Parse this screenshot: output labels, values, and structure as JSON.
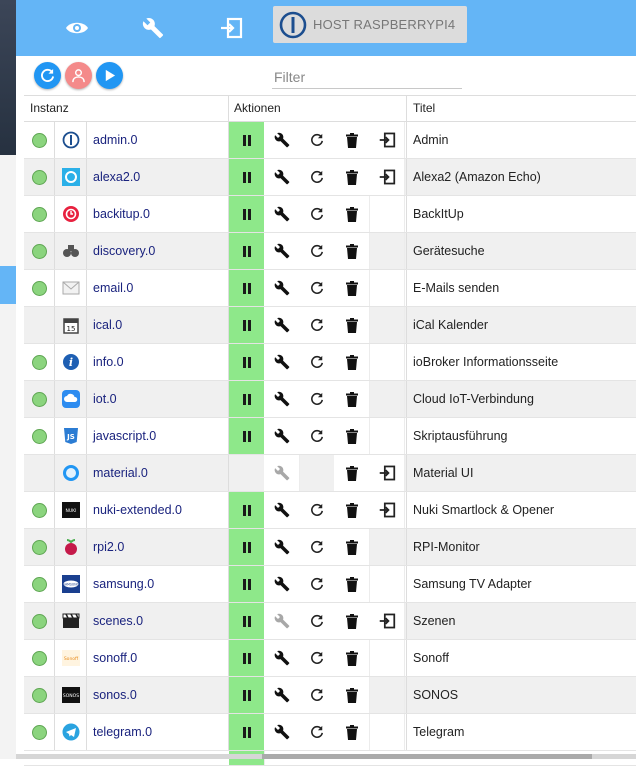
{
  "topbar": {
    "icons": [
      "eye-icon",
      "wrench-icon",
      "login-icon"
    ],
    "host_label": "HOST RASPBERRYPI4"
  },
  "toolbar": {
    "buttons": [
      "refresh-icon",
      "expert-mode-icon",
      "play-icon"
    ],
    "filter_placeholder": "Filter"
  },
  "colors": {
    "accent": "#64b5f6",
    "status_ok": "#8bd47e",
    "pause_bg": "#8ee88a",
    "link": "#1a237e"
  },
  "table": {
    "headers": {
      "instance": "Instanz",
      "actions": "Aktionen",
      "title": "Titel"
    },
    "rows": [
      {
        "instance": "admin.0",
        "title": "Admin",
        "status": true,
        "icon": "iobroker-logo-icon",
        "pause": true,
        "config": true,
        "restart": true,
        "delete": true,
        "open": true
      },
      {
        "instance": "alexa2.0",
        "title": "Alexa2 (Amazon Echo)",
        "status": true,
        "icon": "alexa-icon",
        "pause": true,
        "config": true,
        "restart": true,
        "delete": true,
        "open": true
      },
      {
        "instance": "backitup.0",
        "title": "BackItUp",
        "status": true,
        "icon": "backitup-icon",
        "pause": true,
        "config": true,
        "restart": true,
        "delete": true,
        "open": false
      },
      {
        "instance": "discovery.0",
        "title": "Gerätesuche",
        "status": true,
        "icon": "binoculars-icon",
        "pause": true,
        "config": true,
        "restart": true,
        "delete": true,
        "open": false
      },
      {
        "instance": "email.0",
        "title": "E-Mails senden",
        "status": true,
        "icon": "envelope-icon",
        "pause": true,
        "config": true,
        "restart": true,
        "delete": true,
        "open": false
      },
      {
        "instance": "ical.0",
        "title": "iCal Kalender",
        "status": false,
        "icon": "calendar-icon",
        "pause": true,
        "config": true,
        "restart": true,
        "delete": true,
        "open": false
      },
      {
        "instance": "info.0",
        "title": "ioBroker Informationsseite",
        "status": true,
        "icon": "info-icon",
        "pause": true,
        "config": true,
        "restart": true,
        "delete": true,
        "open": false
      },
      {
        "instance": "iot.0",
        "title": "Cloud IoT-Verbindung",
        "status": true,
        "icon": "cloud-icon",
        "pause": true,
        "config": true,
        "restart": true,
        "delete": true,
        "open": false
      },
      {
        "instance": "javascript.0",
        "title": "Skriptausführung",
        "status": true,
        "icon": "javascript-icon",
        "pause": true,
        "config": true,
        "restart": true,
        "delete": true,
        "open": false
      },
      {
        "instance": "material.0",
        "title": "Material UI",
        "status": false,
        "icon": "material-icon",
        "pause": false,
        "config": "disabled",
        "restart": false,
        "delete": true,
        "open": true
      },
      {
        "instance": "nuki-extended.0",
        "title": "Nuki Smartlock & Opener",
        "status": true,
        "icon": "nuki-icon",
        "pause": true,
        "config": true,
        "restart": true,
        "delete": true,
        "open": true
      },
      {
        "instance": "rpi2.0",
        "title": "RPI-Monitor",
        "status": true,
        "icon": "raspberry-icon",
        "pause": true,
        "config": true,
        "restart": true,
        "delete": true,
        "open": false
      },
      {
        "instance": "samsung.0",
        "title": "Samsung TV Adapter",
        "status": true,
        "icon": "samsung-icon",
        "pause": true,
        "config": true,
        "restart": true,
        "delete": true,
        "open": false
      },
      {
        "instance": "scenes.0",
        "title": "Szenen",
        "status": true,
        "icon": "clapperboard-icon",
        "pause": true,
        "config": "disabled",
        "restart": true,
        "delete": true,
        "open": true
      },
      {
        "instance": "sonoff.0",
        "title": "Sonoff",
        "status": true,
        "icon": "sonoff-icon",
        "pause": true,
        "config": true,
        "restart": true,
        "delete": true,
        "open": false
      },
      {
        "instance": "sonos.0",
        "title": "SONOS",
        "status": true,
        "icon": "sonos-icon",
        "pause": true,
        "config": true,
        "restart": true,
        "delete": true,
        "open": false
      },
      {
        "instance": "telegram.0",
        "title": "Telegram",
        "status": true,
        "icon": "telegram-icon",
        "pause": true,
        "config": true,
        "restart": true,
        "delete": true,
        "open": false
      }
    ]
  }
}
